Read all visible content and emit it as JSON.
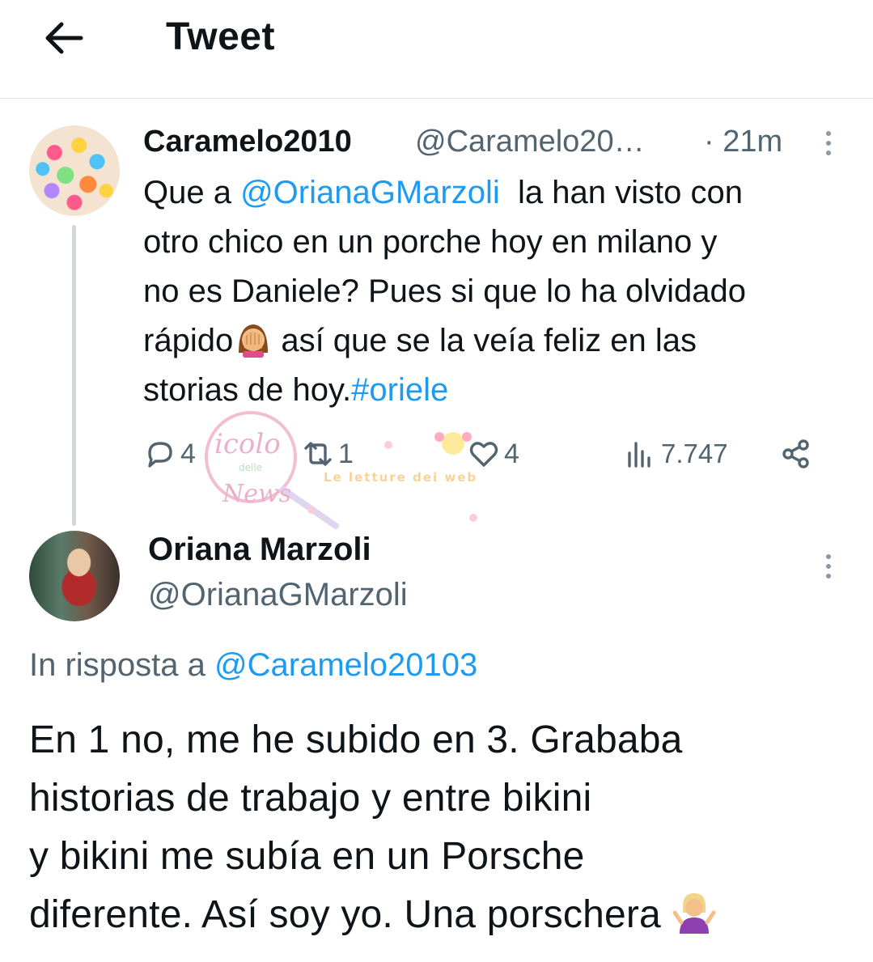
{
  "header": {
    "title": "Tweet",
    "back_icon": "arrow-left-icon"
  },
  "reply_to_tweet": {
    "display_name": "Caramelo2010",
    "handle": "@Caramelo20…",
    "time": "· 21m",
    "text": {
      "line1_prefix": "Que a ",
      "line1_mention": "@OrianaGMarzoli",
      "line1_suffix": "  la han visto con",
      "line2": "otro chico en un porche hoy en milano y",
      "line3": "no es Daniele? Pues si que lo ha olvidado",
      "line4_prefix": "rápido",
      "line4_emoji": "face-palm-emoji",
      "line4_suffix": " así que se la veía feliz en las",
      "line5_prefix": "storias de hoy.",
      "line5_hashtag": "#oriele"
    },
    "actions": {
      "replies": "4",
      "retweets": "1",
      "likes": "4",
      "views": "7.747"
    }
  },
  "watermark": {
    "brand_line1": "icolo",
    "brand_line2": "delle",
    "brand_line3": "News",
    "tagline": "Le letture dei web"
  },
  "main_tweet": {
    "display_name": "Oriana Marzoli",
    "handle": "@OrianaGMarzoli",
    "reply_prefix": "In risposta a ",
    "reply_mention": "@Caramelo20103",
    "text": {
      "line1": "En 1 no, me he subido en 3. Grababa",
      "line2": "historias de trabajo y entre bikini",
      "line3": "y bikini me subía en un Porsche",
      "line4": "diferente. Así soy yo. Una porschera ",
      "line4_emoji": "person-shrugging-emoji"
    }
  },
  "colors": {
    "link": "#1d9bf0",
    "secondary_text": "#536471",
    "primary_text": "#0f1419",
    "divider": "#e1e6ea",
    "thread_line": "#cfd9de"
  }
}
